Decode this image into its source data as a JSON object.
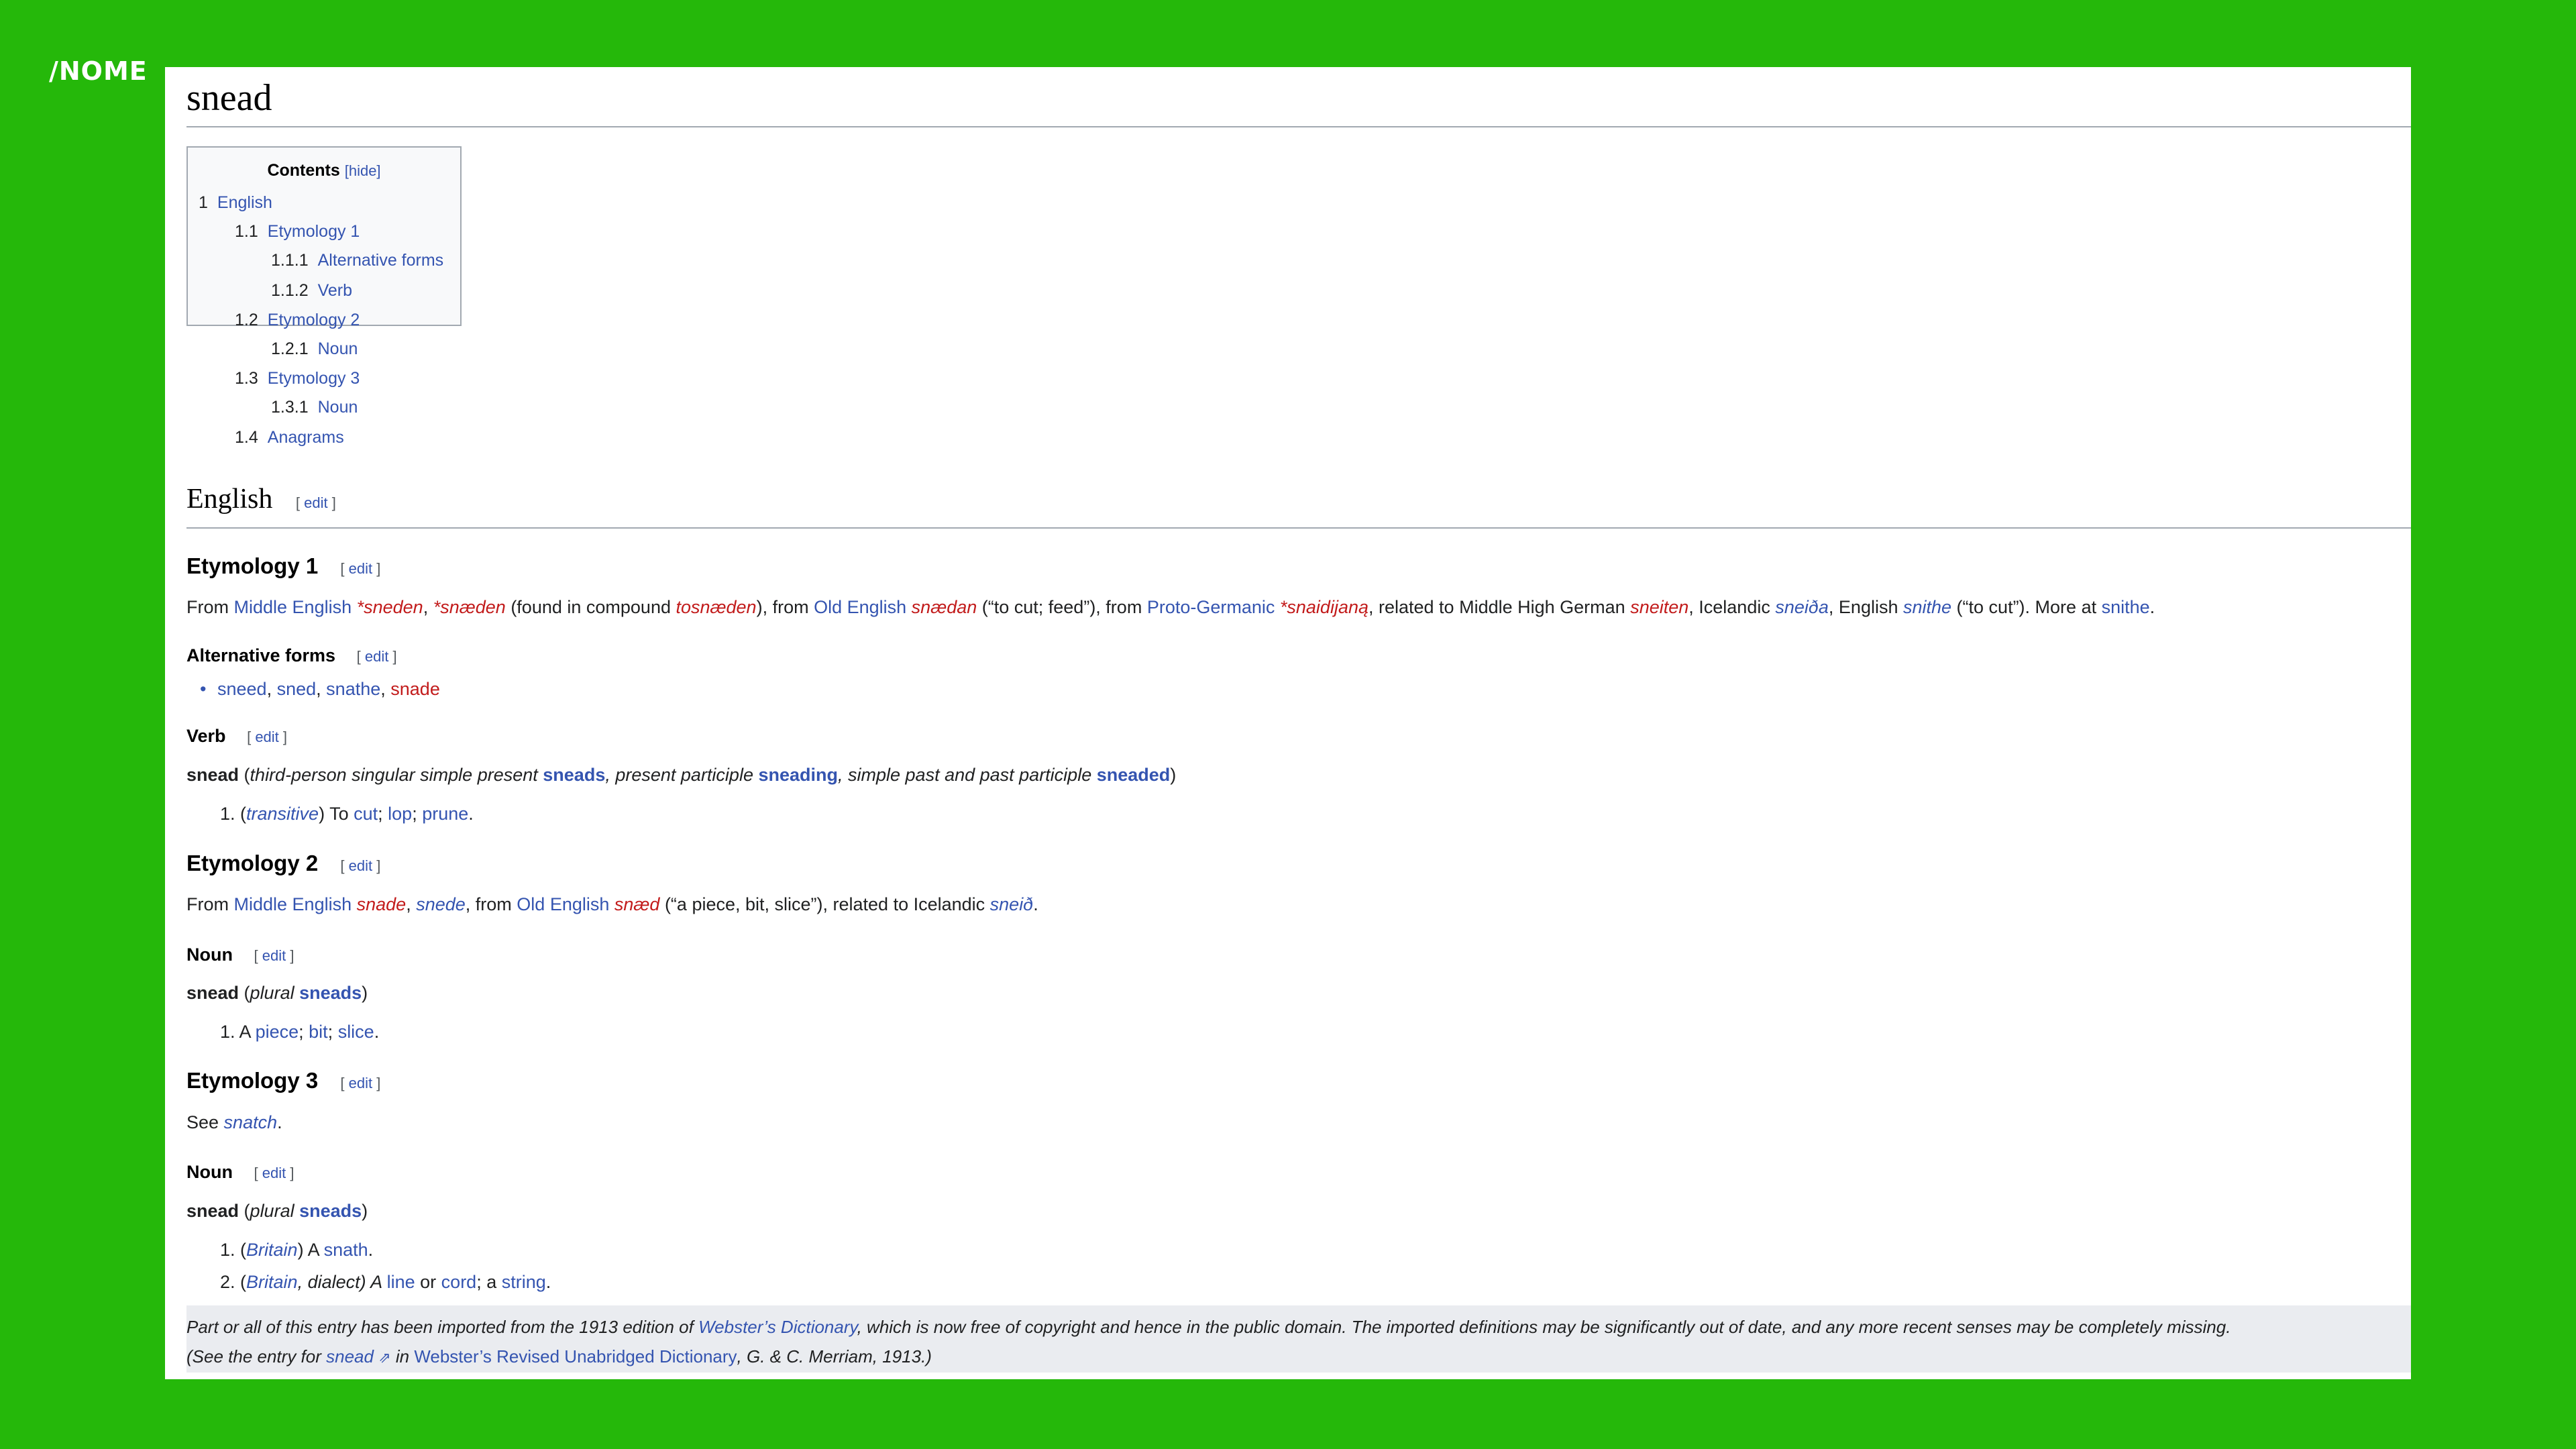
{
  "logo": "/NOME",
  "page": {
    "title": "snead"
  },
  "toc": {
    "title": "Contents",
    "hide": "[hide]",
    "items": [
      {
        "num": "1",
        "label": "English"
      },
      {
        "num": "1.1",
        "label": "Etymology 1"
      },
      {
        "num": "1.1.1",
        "label": "Alternative forms"
      },
      {
        "num": "1.1.2",
        "label": "Verb"
      },
      {
        "num": "1.2",
        "label": "Etymology 2"
      },
      {
        "num": "1.2.1",
        "label": "Noun"
      },
      {
        "num": "1.3",
        "label": "Etymology 3"
      },
      {
        "num": "1.3.1",
        "label": "Noun"
      },
      {
        "num": "1.4",
        "label": "Anagrams"
      }
    ]
  },
  "edit": {
    "open": "[",
    "label": "edit",
    "close": "]"
  },
  "english": {
    "heading": "English"
  },
  "ety1": {
    "heading": "Etymology 1",
    "t1": "From ",
    "l_me": "Middle English",
    "sep": " ",
    "r1": "*sneden",
    "c1": ", ",
    "r2": "*snæden",
    "t2": " (found in compound ",
    "r3": "tosnæden",
    "t3": "), from ",
    "l_oe": "Old English",
    "r4": "snædan",
    "t4": " (“to cut; feed”), from ",
    "l_pg": "Proto-Germanic",
    "r5": "*snaidijaną",
    "t5": ", related to Middle High German ",
    "r6": "sneiten",
    "t6": ", Icelandic ",
    "l_is": "sneiða",
    "t7": ", English ",
    "l_sn": "snithe",
    "t8": " (“to cut”). More at ",
    "l_sn2": "snithe",
    "t9": "."
  },
  "alt": {
    "heading": "Alternative forms",
    "w1": "sneed",
    "w2": "sned",
    "w3": "snathe",
    "w4": "snade",
    "comma": ", "
  },
  "verb": {
    "heading": "Verb",
    "head": "snead",
    "p1": " (",
    "i1": "third-person singular simple present",
    "f1": "sneads",
    "i2": ", present participle",
    "f2": "sneading",
    "i3": ", simple past and past participle",
    "f3": "sneaded",
    "p2": ")",
    "d_num": "1.",
    "d_o": " (",
    "d_label": "transitive",
    "d_c": ") To ",
    "d_w1": "cut",
    "d_s1": "; ",
    "d_w2": "lop",
    "d_s2": "; ",
    "d_w3": "prune",
    "d_end": "."
  },
  "ety2": {
    "heading": "Etymology 2",
    "t1": "From ",
    "l_me": "Middle English",
    "r1": "snade",
    "c1": ", ",
    "l_snede": "snede",
    "t2": ", from ",
    "l_oe": "Old English",
    "r2": "snæd",
    "t3": " (“a piece, bit, slice”), related to Icelandic ",
    "l_sneid": "sneið",
    "t4": "."
  },
  "noun1": {
    "heading": "Noun",
    "head": "snead",
    "p1": " (",
    "i1": "plural",
    "f1": "sneads",
    "p2": ")",
    "d_num": "1.",
    "d_a": " A ",
    "d_w1": "piece",
    "d_s1": "; ",
    "d_w2": "bit",
    "d_s2": "; ",
    "d_w3": "slice",
    "d_end": "."
  },
  "ety3": {
    "heading": "Etymology 3",
    "t1": "See ",
    "l_snatch": "snatch",
    "t2": "."
  },
  "noun2": {
    "heading": "Noun",
    "head": "snead",
    "p1": " (",
    "i1": "plural",
    "f1": "sneads",
    "p2": ")",
    "d1_num": "1.",
    "d1_o": " (",
    "d1_label": "Britain",
    "d1_c": ") A ",
    "d1_w1": "snath",
    "d1_end": ".",
    "d2_num": "2.",
    "d2_o": " (",
    "d2_label": "Britain",
    "d2_c": ", dialect) A ",
    "d2_w1": "line",
    "d2_or": " or ",
    "d2_w2": "cord",
    "d2_a": "; a ",
    "d2_w3": "string",
    "d2_end": "."
  },
  "footer": {
    "t1": "Part or all of this entry has been imported from the 1913 edition of ",
    "l_web": "Webster’s Dictionary",
    "t2": ", which is now free of copyright and hence in the public domain. The imported definitions may be significantly out of date, and any more recent senses may be completely missing.",
    "t3": "(See the entry for ",
    "l_snead": "snead",
    "ext": "⇗",
    "t4": " in ",
    "l_wrud": "Webster’s Revised Unabridged Dictionary",
    "t5": ", G. & C. Merriam, 1913.)"
  }
}
